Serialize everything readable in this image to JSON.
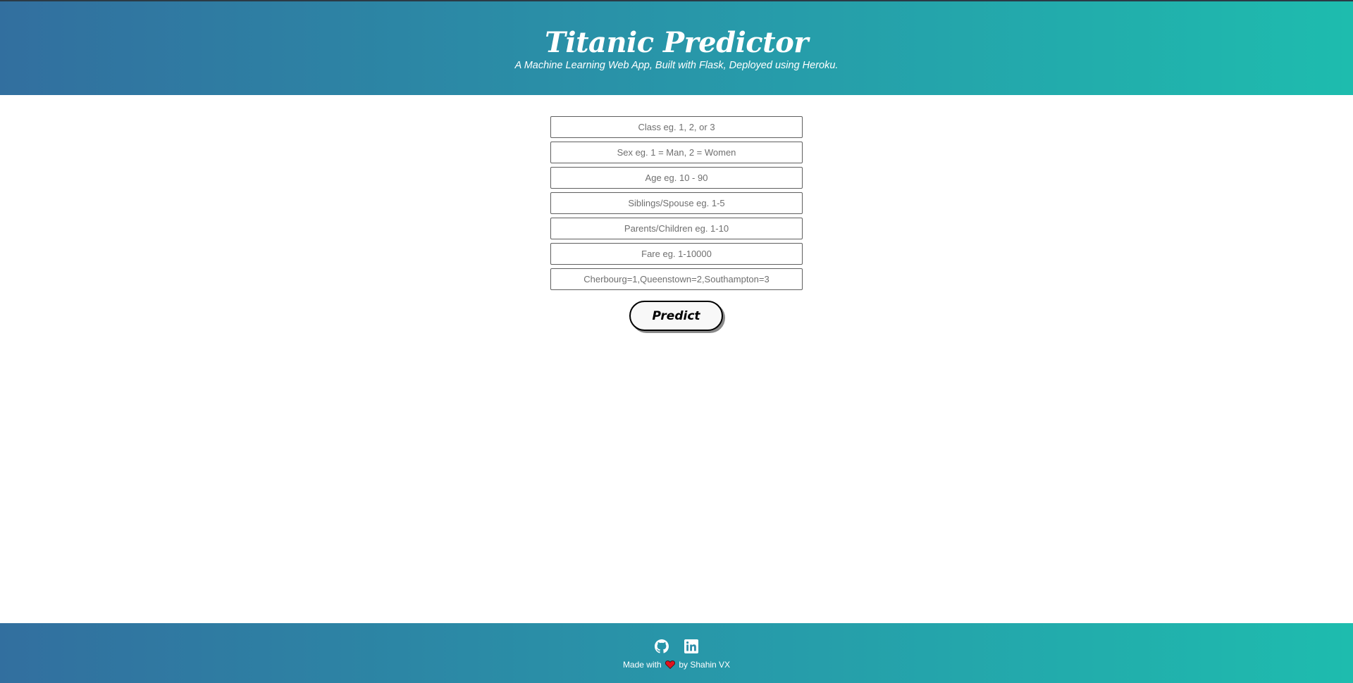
{
  "header": {
    "title": "Titanic Predictor",
    "subtitle": "A Machine Learning Web App, Built with Flask, Deployed using Heroku."
  },
  "form": {
    "fields": [
      {
        "name": "class",
        "placeholder": "Class eg. 1, 2, or 3"
      },
      {
        "name": "sex",
        "placeholder": "Sex eg. 1 = Man, 2 = Women"
      },
      {
        "name": "age",
        "placeholder": "Age eg. 10 - 90"
      },
      {
        "name": "siblings-spouse",
        "placeholder": "Siblings/Spouse eg. 1-5"
      },
      {
        "name": "parents-children",
        "placeholder": "Parents/Children eg. 1-10"
      },
      {
        "name": "fare",
        "placeholder": "Fare eg. 1-10000"
      },
      {
        "name": "embarked",
        "placeholder": "Cherbourg=1,Queenstown=2,Southampton=3"
      }
    ],
    "submit_label": "Predict"
  },
  "footer": {
    "icons": [
      "github-icon",
      "linkedin-icon",
      "heart-icon"
    ],
    "made_with": "Made with",
    "by": "by Shahin VX"
  },
  "colors": {
    "gradient_start": "#326f9f",
    "gradient_end": "#1ebcae",
    "heart": "#e0141e"
  }
}
